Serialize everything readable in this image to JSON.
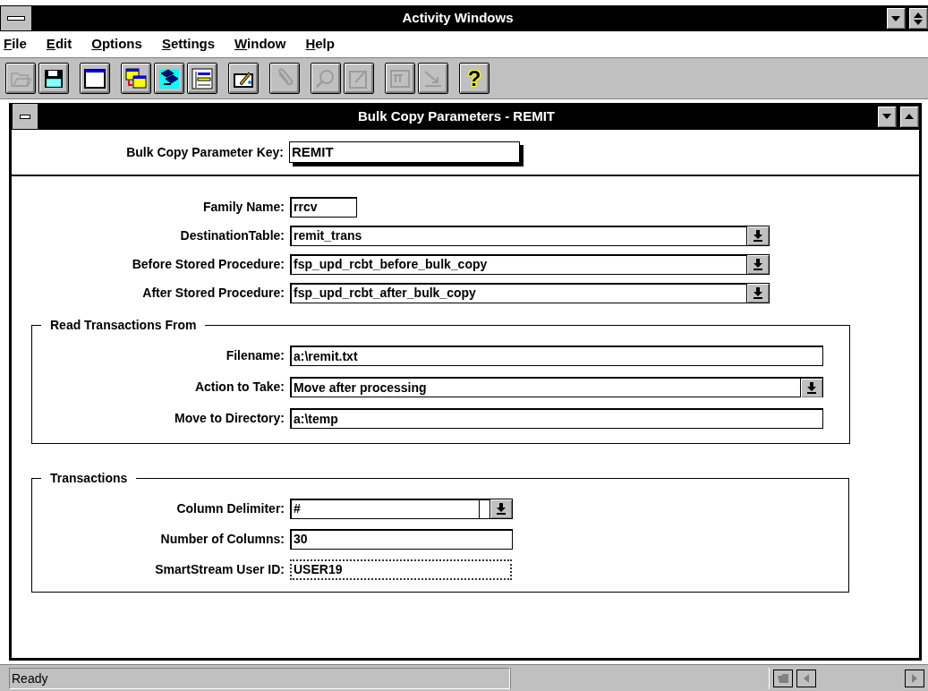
{
  "window": {
    "title": "Activity Windows"
  },
  "menu": [
    {
      "label": "File"
    },
    {
      "label": "Edit"
    },
    {
      "label": "Options"
    },
    {
      "label": "Settings"
    },
    {
      "label": "Window"
    },
    {
      "label": "Help"
    }
  ],
  "toolbar": [
    {
      "kind": "open",
      "disabled": true
    },
    {
      "kind": "save",
      "disabled": false
    },
    {
      "kind": "window",
      "disabled": false
    },
    {
      "kind": "table-copy",
      "disabled": false
    },
    {
      "kind": "transfer",
      "disabled": false
    },
    {
      "kind": "list",
      "disabled": false
    },
    {
      "kind": "edit",
      "disabled": false
    },
    {
      "kind": "clip",
      "disabled": true
    },
    {
      "kind": "find",
      "disabled": true
    },
    {
      "kind": "note",
      "disabled": true
    },
    {
      "kind": "form",
      "disabled": true
    },
    {
      "kind": "arrow",
      "disabled": true
    },
    {
      "kind": "help",
      "label": "?",
      "disabled": false
    }
  ],
  "child_window": {
    "title": "Bulk Copy Parameters -  REMIT",
    "key_field": {
      "label": "Bulk Copy Parameter Key:",
      "value": "REMIT"
    },
    "fields": [
      {
        "label": "Family Name:",
        "value": "rrcv",
        "kind": "text",
        "focused": false
      },
      {
        "label": "DestinationTable:",
        "value": "remit_trans",
        "kind": "dropdown",
        "focused": false
      },
      {
        "label": "Before Stored Procedure:",
        "value": "fsp_upd_rcbt_before_bulk_copy",
        "kind": "dropdown",
        "focused": false
      },
      {
        "label": "After Stored Procedure:",
        "value": "fsp_upd_rcbt_after_bulk_copy",
        "kind": "dropdown",
        "focused": false
      }
    ],
    "groups": [
      {
        "title": "Read Transactions From",
        "fields": [
          {
            "label": "Filename:",
            "value": "a:\\remit.txt",
            "kind": "text",
            "focused": false
          },
          {
            "label": "Action to Take:",
            "value": "Move after processing",
            "kind": "dropdown",
            "focused": false
          },
          {
            "label": "Move to Directory:",
            "value": "a:\\temp",
            "kind": "text",
            "focused": false
          }
        ]
      },
      {
        "title": "Transactions",
        "fields": [
          {
            "label": "Column Delimiter:",
            "value": "#",
            "kind": "combo",
            "focused": false
          },
          {
            "label": "Number of Columns:",
            "value": "30",
            "kind": "text",
            "focused": false
          },
          {
            "label": "SmartStream User ID:",
            "value": "USER19",
            "kind": "text",
            "focused": true
          }
        ]
      }
    ]
  },
  "status_bar": {
    "text": "Ready"
  }
}
